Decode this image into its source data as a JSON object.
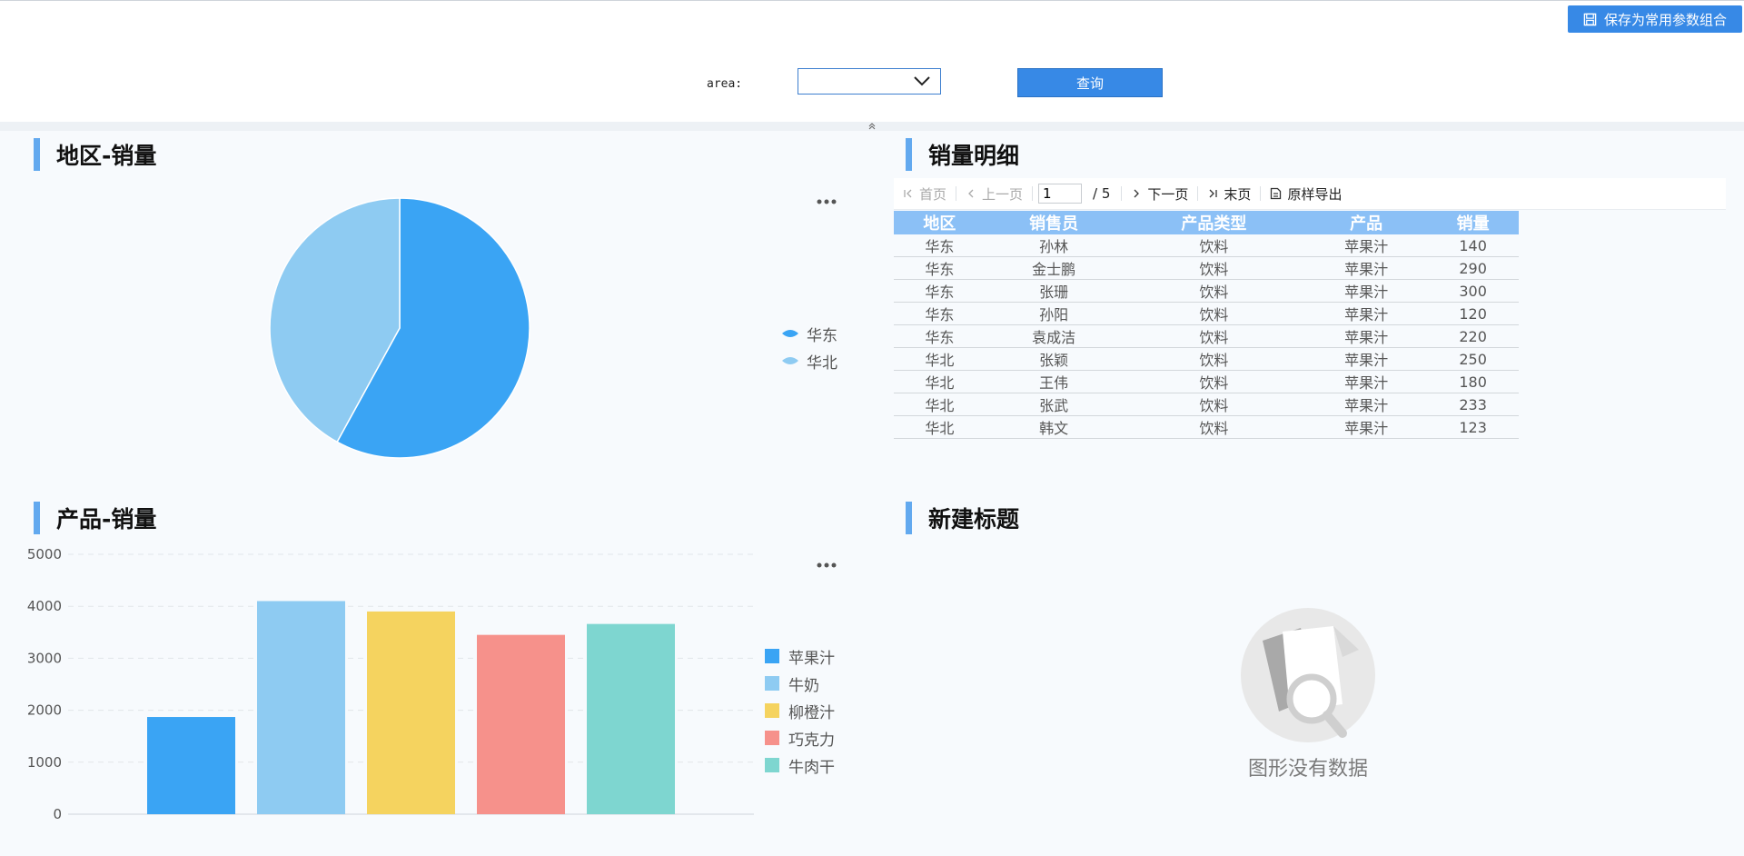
{
  "toolbar": {
    "save_label": "保存为常用参数组合",
    "save_icon": "save-icon"
  },
  "params": {
    "area_label": "area:",
    "area_value": "",
    "query_label": "查询"
  },
  "colors": {
    "accent": "#3789e6",
    "title_bar": "#62a9ef",
    "table_header": "#8bc0f6"
  },
  "widgets": {
    "pie_title": "地区-销量",
    "detail_title": "销量明细",
    "bar_title": "产品-销量",
    "new_title": "新建标题"
  },
  "pager": {
    "first": "首页",
    "prev": "上一页",
    "page": "1",
    "total": "/ 5",
    "next": "下一页",
    "last": "末页",
    "export": "原样导出"
  },
  "table": {
    "columns": [
      "地区",
      "销售员",
      "产品类型",
      "产品",
      "销量"
    ],
    "rows": [
      [
        "华东",
        "孙林",
        "饮料",
        "苹果汁",
        "140"
      ],
      [
        "华东",
        "金士鹏",
        "饮料",
        "苹果汁",
        "290"
      ],
      [
        "华东",
        "张珊",
        "饮料",
        "苹果汁",
        "300"
      ],
      [
        "华东",
        "孙阳",
        "饮料",
        "苹果汁",
        "120"
      ],
      [
        "华东",
        "袁成洁",
        "饮料",
        "苹果汁",
        "220"
      ],
      [
        "华北",
        "张颖",
        "饮料",
        "苹果汁",
        "250"
      ],
      [
        "华北",
        "王伟",
        "饮料",
        "苹果汁",
        "180"
      ],
      [
        "华北",
        "张武",
        "饮料",
        "苹果汁",
        "233"
      ],
      [
        "华北",
        "韩文",
        "饮料",
        "苹果汁",
        "123"
      ]
    ]
  },
  "empty_state": {
    "text": "图形没有数据"
  },
  "chart_data": [
    {
      "type": "pie",
      "title": "地区-销量",
      "categories": [
        "华东",
        "华北"
      ],
      "values": [
        58,
        42
      ],
      "colors": [
        "#3aa4f4",
        "#8ecbf2"
      ],
      "legend": "right"
    },
    {
      "type": "bar",
      "title": "产品-销量",
      "categories": [
        "苹果汁",
        "牛奶",
        "柳橙汁",
        "巧克力",
        "牛肉干"
      ],
      "values": [
        1870,
        4100,
        3900,
        3450,
        3660
      ],
      "colors": [
        "#3aa4f4",
        "#8ecbf2",
        "#f5d35f",
        "#f6918b",
        "#7ed6d0"
      ],
      "ylim": [
        0,
        5000
      ],
      "yticks": [
        0,
        1000,
        2000,
        3000,
        4000,
        5000
      ],
      "grid": true,
      "legend": "right"
    }
  ]
}
